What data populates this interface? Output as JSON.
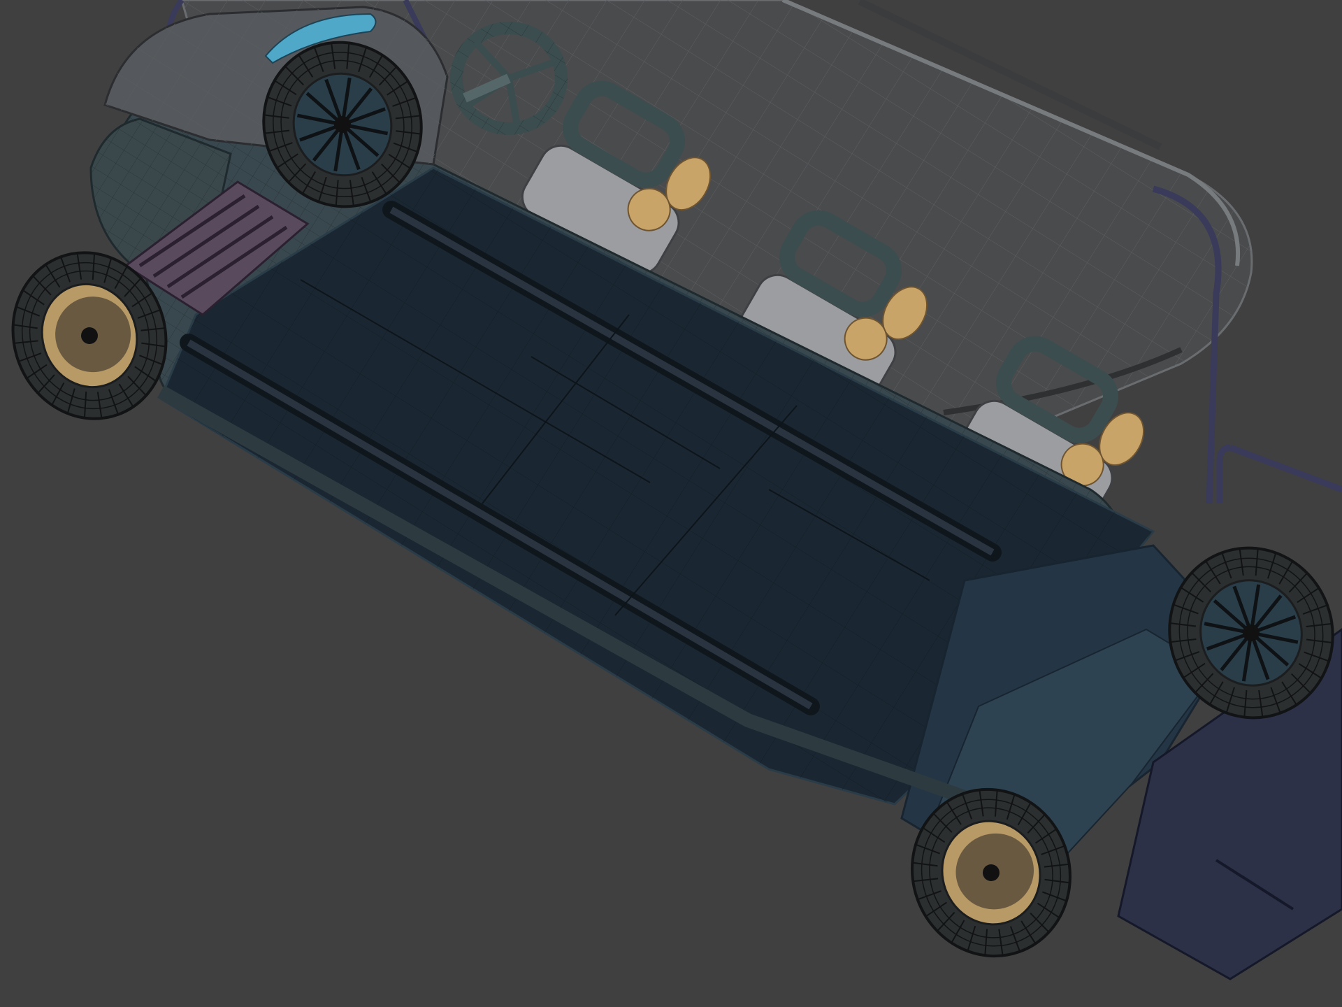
{
  "scene": {
    "background": "#404040",
    "subject": "wireframe-3d-model-underside-view",
    "colors": {
      "floor_dark": "#1a2732",
      "floor_mid": "#243645",
      "body_edge": "#39484e",
      "canopy": "#4a4b4d",
      "canopy_edge": "#6a6d70",
      "seat_frame": "#3c4d4f",
      "seat_cushion": "#9b9da1",
      "seat_accent": "#c9a468",
      "tire": "#2c2f30",
      "tire_line": "#111314",
      "rim_gold": "#b89a66",
      "rim_blue": "#2a3e4a",
      "light_cyan": "#4fa8c8",
      "battery_purple": "#5a4a5e",
      "rear_plate": "#2d3148"
    }
  },
  "wheels": [
    {
      "name": "wheel-front-left",
      "rim": "gold"
    },
    {
      "name": "wheel-front-right",
      "rim": "spoked"
    },
    {
      "name": "wheel-rear-left",
      "rim": "gold"
    },
    {
      "name": "wheel-rear-right",
      "rim": "spoked"
    }
  ],
  "seats": [
    {
      "name": "seat-row-1"
    },
    {
      "name": "seat-row-2"
    },
    {
      "name": "seat-row-3"
    }
  ]
}
